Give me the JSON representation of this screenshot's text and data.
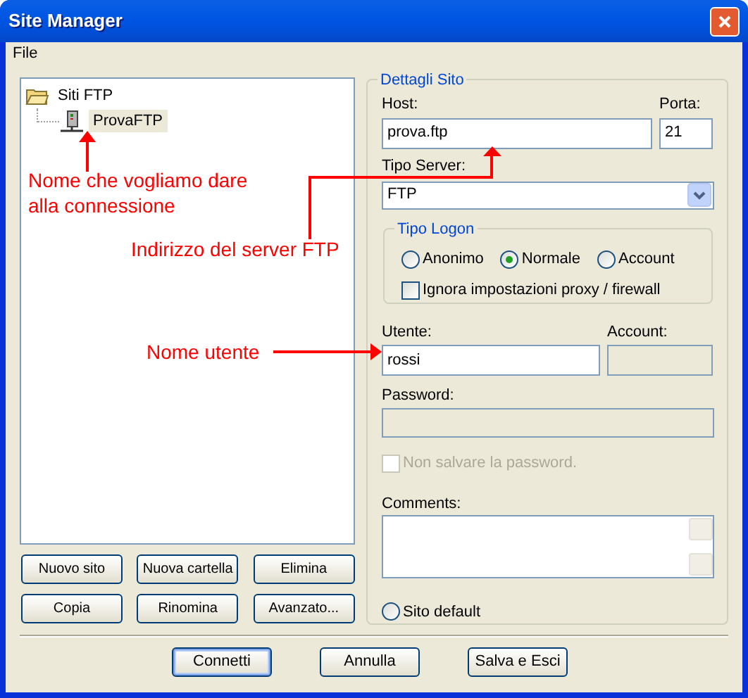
{
  "window": {
    "title": "Site Manager"
  },
  "menu": [
    "File"
  ],
  "tree": [
    {
      "label": "Siti FTP",
      "kind": "folder",
      "selected": false,
      "children": [
        {
          "label": "ProvaFTP",
          "kind": "site",
          "selected": true
        }
      ]
    }
  ],
  "site_buttons": [
    "Nuovo sito",
    "Nuova cartella",
    "Elimina",
    "Copia",
    "Rinomina",
    "Avanzato..."
  ],
  "details": {
    "title": "Dettagli Sito",
    "host": {
      "label": "Host:",
      "value": "prova.ftp"
    },
    "port": {
      "label": "Porta:",
      "value": "21"
    },
    "server_type": {
      "label": "Tipo Server:",
      "value": "FTP"
    },
    "logon": {
      "title": "Tipo Logon",
      "options": [
        {
          "label": "Anonimo",
          "selected": false
        },
        {
          "label": "Normale",
          "selected": true
        },
        {
          "label": "Account",
          "selected": false
        }
      ],
      "bypass_proxy": {
        "label": "Ignora impostazioni proxy / firewall",
        "checked": false
      }
    },
    "user": {
      "label": "Utente:",
      "value": "rossi"
    },
    "account": {
      "label": "Account:",
      "disabled": true
    },
    "password": {
      "label": "Password:",
      "disabled": true
    },
    "save_password": {
      "label": "Non salvare la password.",
      "checked": false,
      "disabled": true
    },
    "comments": {
      "label": "Comments:"
    },
    "default_site": {
      "label": "Sito default",
      "selected": false
    }
  },
  "dialog_buttons": [
    {
      "label": "Connetti",
      "default": true
    },
    {
      "label": "Annulla",
      "default": false
    },
    {
      "label": "Salva e Esci",
      "default": false
    }
  ],
  "annotations": [
    {
      "text": "Nome che vogliamo dare alla connessione"
    },
    {
      "text": "Indirizzo del server FTP"
    },
    {
      "text": "Nome utente"
    }
  ]
}
